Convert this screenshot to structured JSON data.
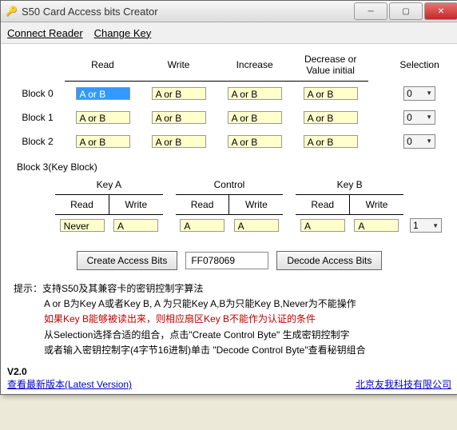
{
  "window": {
    "title": "S50 Card Access bits Creator"
  },
  "menu": {
    "connect": "Connect Reader",
    "changekey": "Change Key"
  },
  "headers": {
    "read": "Read",
    "write": "Write",
    "increase": "Increase",
    "decrease": "Decrease or\nValue initial",
    "selection": "Selection"
  },
  "blocks": [
    {
      "label": "Block 0",
      "read": "A or B",
      "write": "A or B",
      "increase": "A or B",
      "decrease": "A or B",
      "sel": "0"
    },
    {
      "label": "Block 1",
      "read": "A or B",
      "write": "A or B",
      "increase": "A or B",
      "decrease": "A or B",
      "sel": "0"
    },
    {
      "label": "Block 2",
      "read": "A or B",
      "write": "A or B",
      "increase": "A or B",
      "decrease": "A or B",
      "sel": "0"
    }
  ],
  "block3": {
    "label": "Block 3(Key Block)",
    "groups": {
      "keya": "Key A",
      "control": "Control",
      "keyb": "Key B"
    },
    "sub": {
      "read": "Read",
      "write": "Write"
    },
    "vals": {
      "keya_read": "Never",
      "keya_write": "A",
      "ctrl_read": "A",
      "ctrl_write": "A",
      "keyb_read": "A",
      "keyb_write": "A"
    },
    "sel": "1"
  },
  "actions": {
    "create": "Create Access Bits",
    "hex": "FF078069",
    "decode": "Decode Access Bits"
  },
  "info": {
    "l1": "提示：支持S50及其兼容卡的密钥控制字算法",
    "l2": "A or B为Key A或者Key B, A 为只能Key A,B为只能Key B,Never为不能操作",
    "l3": "如果Key B能够被读出来，则相应扇区Key B不能作为认证的条件",
    "l4": "从Selection选择合适的组合，点击\"Create Control Byte\" 生成密钥控制字",
    "l5": "或者输入密钥控制字(4字节16进制)单击 \"Decode Control Byte\"查看秘钥组合"
  },
  "footer": {
    "version": "V2.0",
    "latest": "查看最新版本(Latest Version)",
    "company": "北京友我科技有限公司"
  }
}
